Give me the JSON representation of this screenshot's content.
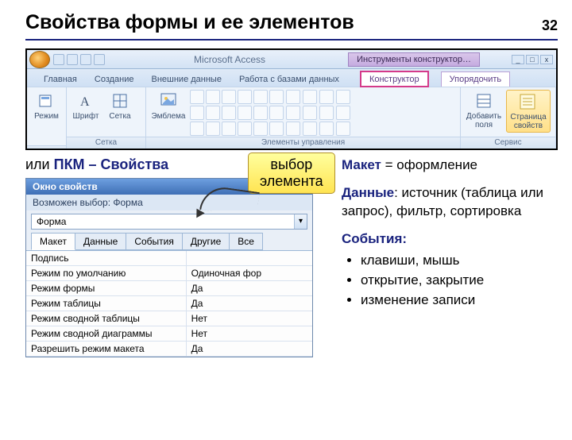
{
  "page_number": "32",
  "title": "Свойства формы и ее элементов",
  "ribbon": {
    "app_title": "Microsoft Access",
    "context_title": "Инструменты конструктор…",
    "tabs": [
      "Главная",
      "Создание",
      "Внешние данные",
      "Работа с базами данных"
    ],
    "context_tabs": [
      "Конструктор",
      "Упорядочить"
    ],
    "groups": {
      "g1": {
        "btn1": "Режим",
        "label": ""
      },
      "g2": {
        "btn1": "Шрифт",
        "btn2": "Сетка",
        "label": "Сетка"
      },
      "g3": {
        "btn1": "Эмблема",
        "label": "Элементы управления"
      },
      "g4": {
        "btn1": "Добавить\nполя",
        "btn2": "Страница\nсвойств",
        "label": "Сервис"
      }
    }
  },
  "pkm": {
    "prefix": "или ",
    "strong": "ПКМ – Свойства"
  },
  "callout": {
    "line1": "выбор",
    "line2": "элемента"
  },
  "propwin": {
    "title": "Окно свойств",
    "close": "x",
    "subtitle": "Возможен выбор:  Форма",
    "combo_value": "Форма",
    "tabs": [
      "Макет",
      "Данные",
      "События",
      "Другие",
      "Все"
    ],
    "rows": [
      {
        "k": "Подпись",
        "v": ""
      },
      {
        "k": "Режим по умолчанию",
        "v": "Одиночная фор"
      },
      {
        "k": "Режим формы",
        "v": "Да"
      },
      {
        "k": "Режим таблицы",
        "v": "Да"
      },
      {
        "k": "Режим сводной таблицы",
        "v": "Нет"
      },
      {
        "k": "Режим сводной диаграммы",
        "v": "Нет"
      },
      {
        "k": "Разрешить режим макета",
        "v": "Да"
      }
    ]
  },
  "notes": {
    "maket_term": "Макет",
    "maket_rest": " = оформление",
    "dannye_term": "Данные",
    "dannye_rest": ": источник (таблица или запрос), фильтр, сортировка",
    "sob_term": "События:",
    "sob_items": [
      "клавиши, мышь",
      "открытие, закрытие",
      "изменение записи"
    ]
  }
}
